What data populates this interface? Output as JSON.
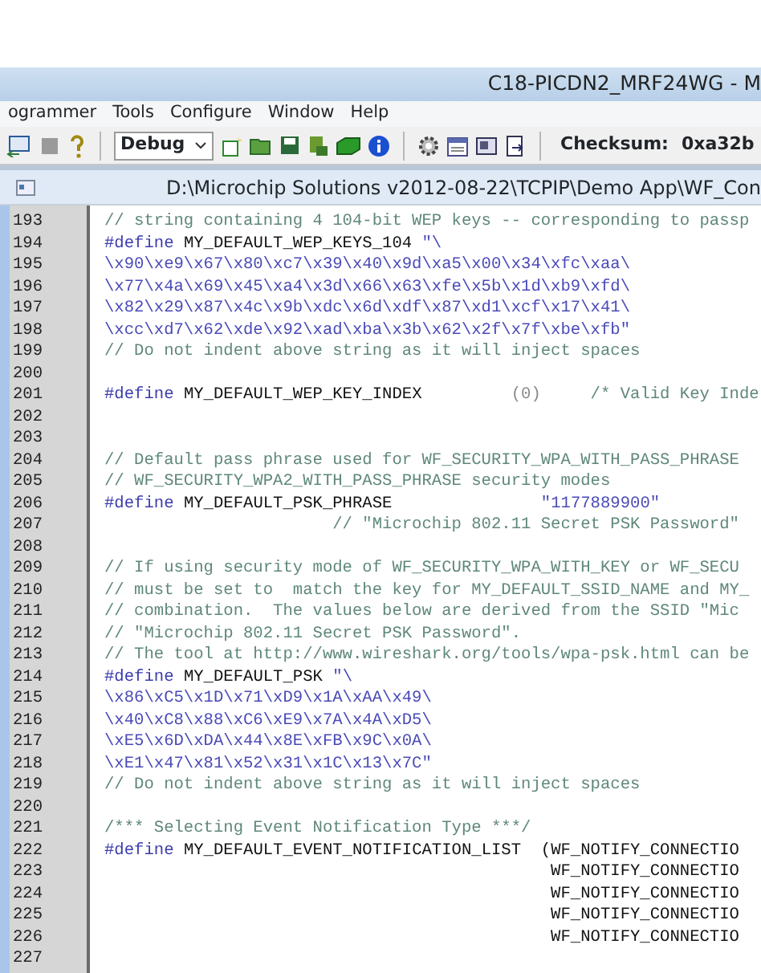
{
  "window": {
    "title": "C18-PICDN2_MRF24WG - M"
  },
  "menu": [
    "ogrammer",
    "Tools",
    "Configure",
    "Window",
    "Help"
  ],
  "toolbar": {
    "build_config": "Debug",
    "checksum_label": "Checksum:",
    "checksum_value": "0xa32b"
  },
  "editor": {
    "title": "D:\\Microchip Solutions v2012-08-22\\TCPIP\\Demo App\\WF_Con",
    "lines": [
      {
        "number": "193",
        "tokens": [
          {
            "kind": "comment",
            "text": "// string containing 4 104-bit WEP keys -- corresponding to passp"
          }
        ]
      },
      {
        "number": "194",
        "tokens": [
          {
            "kind": "directive",
            "text": "#define"
          },
          {
            "kind": "text",
            "text": " MY_DEFAULT_WEP_KEYS_104 "
          },
          {
            "kind": "string",
            "text": "\"\\"
          }
        ]
      },
      {
        "number": "195",
        "tokens": [
          {
            "kind": "string",
            "text": "\\x90\\xe9\\x67\\x80\\xc7\\x39\\x40\\x9d\\xa5\\x00\\x34\\xfc\\xaa\\"
          }
        ]
      },
      {
        "number": "196",
        "tokens": [
          {
            "kind": "string",
            "text": "\\x77\\x4a\\x69\\x45\\xa4\\x3d\\x66\\x63\\xfe\\x5b\\x1d\\xb9\\xfd\\"
          }
        ]
      },
      {
        "number": "197",
        "tokens": [
          {
            "kind": "string",
            "text": "\\x82\\x29\\x87\\x4c\\x9b\\xdc\\x6d\\xdf\\x87\\xd1\\xcf\\x17\\x41\\"
          }
        ]
      },
      {
        "number": "198",
        "tokens": [
          {
            "kind": "string",
            "text": "\\xcc\\xd7\\x62\\xde\\x92\\xad\\xba\\x3b\\x62\\x2f\\x7f\\xbe\\xfb\""
          }
        ]
      },
      {
        "number": "199",
        "tokens": [
          {
            "kind": "comment",
            "text": "// Do not indent above string as it will inject spaces"
          }
        ]
      },
      {
        "number": "200"
      },
      {
        "number": "201",
        "tokens": [
          {
            "kind": "directive",
            "text": "#define"
          },
          {
            "kind": "text",
            "text": " MY_DEFAULT_WEP_KEY_INDEX         "
          },
          {
            "kind": "number",
            "text": "(0)"
          },
          {
            "kind": "comment",
            "text": "     /* Valid Key Inde"
          }
        ]
      },
      {
        "number": "202"
      },
      {
        "number": "203"
      },
      {
        "number": "204",
        "tokens": [
          {
            "kind": "comment",
            "text": "// Default pass phrase used for WF_SECURITY_WPA_WITH_PASS_PHRASE"
          }
        ]
      },
      {
        "number": "205",
        "tokens": [
          {
            "kind": "comment",
            "text": "// WF_SECURITY_WPA2_WITH_PASS_PHRASE security modes"
          }
        ]
      },
      {
        "number": "206",
        "tokens": [
          {
            "kind": "directive",
            "text": "#define"
          },
          {
            "kind": "text",
            "text": " MY_DEFAULT_PSK_PHRASE               "
          },
          {
            "kind": "string",
            "text": "\"1177889900\""
          }
        ]
      },
      {
        "number": "207",
        "tokens": [
          {
            "kind": "comment",
            "text": "                       // \"Microchip 802.11 Secret PSK Password\""
          }
        ]
      },
      {
        "number": "208"
      },
      {
        "number": "209",
        "tokens": [
          {
            "kind": "comment",
            "text": "// If using security mode of WF_SECURITY_WPA_WITH_KEY or WF_SECU"
          }
        ]
      },
      {
        "number": "210",
        "tokens": [
          {
            "kind": "comment",
            "text": "// must be set to  match the key for MY_DEFAULT_SSID_NAME and MY_"
          }
        ]
      },
      {
        "number": "211",
        "tokens": [
          {
            "kind": "comment",
            "text": "// combination.  The values below are derived from the SSID \"Mic"
          }
        ]
      },
      {
        "number": "212",
        "tokens": [
          {
            "kind": "comment",
            "text": "// \"Microchip 802.11 Secret PSK Password\"."
          }
        ]
      },
      {
        "number": "213",
        "tokens": [
          {
            "kind": "comment",
            "text": "// The tool at http://www.wireshark.org/tools/wpa-psk.html can be"
          }
        ]
      },
      {
        "number": "214",
        "tokens": [
          {
            "kind": "directive",
            "text": "#define"
          },
          {
            "kind": "text",
            "text": " MY_DEFAULT_PSK "
          },
          {
            "kind": "string",
            "text": "\"\\"
          }
        ]
      },
      {
        "number": "215",
        "tokens": [
          {
            "kind": "string",
            "text": "\\x86\\xC5\\x1D\\x71\\xD9\\x1A\\xAA\\x49\\"
          }
        ]
      },
      {
        "number": "216",
        "tokens": [
          {
            "kind": "string",
            "text": "\\x40\\xC8\\x88\\xC6\\xE9\\x7A\\x4A\\xD5\\"
          }
        ]
      },
      {
        "number": "217",
        "tokens": [
          {
            "kind": "string",
            "text": "\\xE5\\x6D\\xDA\\x44\\x8E\\xFB\\x9C\\x0A\\"
          }
        ]
      },
      {
        "number": "218",
        "tokens": [
          {
            "kind": "string",
            "text": "\\xE1\\x47\\x81\\x52\\x31\\x1C\\x13\\x7C\""
          }
        ]
      },
      {
        "number": "219",
        "tokens": [
          {
            "kind": "comment",
            "text": "// Do not indent above string as it will inject spaces"
          }
        ]
      },
      {
        "number": "220"
      },
      {
        "number": "221",
        "tokens": [
          {
            "kind": "comment",
            "text": "/*** Selecting Event Notification Type ***/"
          }
        ]
      },
      {
        "number": "222",
        "tokens": [
          {
            "kind": "directive",
            "text": "#define"
          },
          {
            "kind": "text",
            "text": " MY_DEFAULT_EVENT_NOTIFICATION_LIST  (WF_NOTIFY_CONNECTIO"
          }
        ]
      },
      {
        "number": "223",
        "tokens": [
          {
            "kind": "text",
            "text": "                                             WF_NOTIFY_CONNECTIO"
          }
        ]
      },
      {
        "number": "224",
        "tokens": [
          {
            "kind": "text",
            "text": "                                             WF_NOTIFY_CONNECTIO"
          }
        ]
      },
      {
        "number": "225",
        "tokens": [
          {
            "kind": "text",
            "text": "                                             WF_NOTIFY_CONNECTIO"
          }
        ]
      },
      {
        "number": "226",
        "tokens": [
          {
            "kind": "text",
            "text": "                                             WF_NOTIFY_CONNECTIO"
          }
        ]
      },
      {
        "number": "227"
      }
    ]
  }
}
